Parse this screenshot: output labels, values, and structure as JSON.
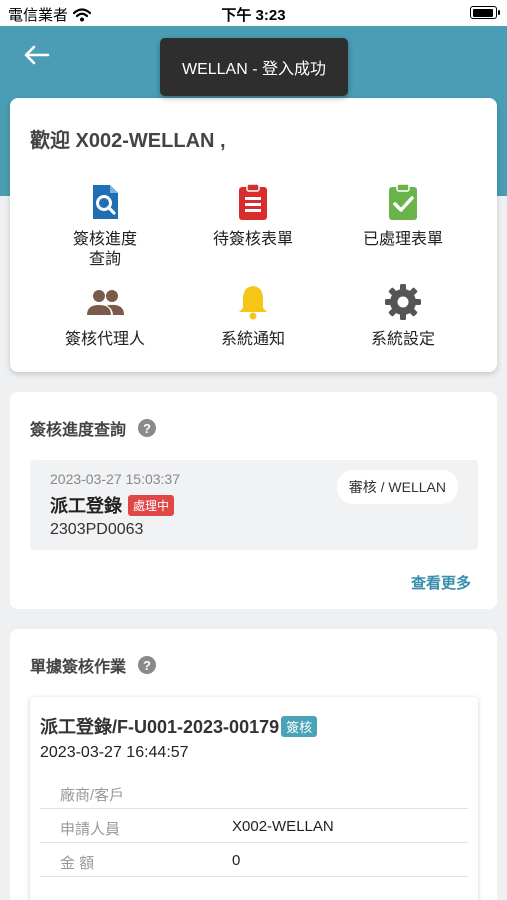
{
  "status_bar": {
    "carrier": "電信業者",
    "time": "下午 3:23"
  },
  "toast": {
    "message": "WELLAN - 登入成功"
  },
  "welcome": {
    "greeting": "歡迎 X002-WELLAN ,",
    "menu": [
      {
        "label": "簽核進度\n查詢",
        "icon": "document-search-icon",
        "color": "#1e6fb3"
      },
      {
        "label": "待簽核表單",
        "icon": "clipboard-list-icon",
        "color": "#d92c2c"
      },
      {
        "label": "已處理表單",
        "icon": "clipboard-check-icon",
        "color": "#6ab34a"
      },
      {
        "label": "簽核代理人",
        "icon": "people-icon",
        "color": "#7a5a4a"
      },
      {
        "label": "系統通知",
        "icon": "bell-icon",
        "color": "#f5c518"
      },
      {
        "label": "系統設定",
        "icon": "gear-icon",
        "color": "#555555"
      }
    ]
  },
  "progress": {
    "title": "簽核進度查詢",
    "item": {
      "time": "2023-03-27 15:03:37",
      "title": "派工登錄",
      "status": "處理中",
      "code": "2303PD0063",
      "tag": "審核 / WELLAN"
    },
    "more": "查看更多"
  },
  "documents": {
    "title": "單據簽核作業",
    "item": {
      "title": "派工登錄/F-U001-2023-00179",
      "badge": "簽核",
      "time": "2023-03-27 16:44:57",
      "rows": [
        {
          "key": "廠商/客戶",
          "value": ""
        },
        {
          "key": "申請人員",
          "value": "X002-WELLAN"
        },
        {
          "key": "金 額",
          "value": "0"
        }
      ]
    }
  },
  "colors": {
    "header": "#4a9db5",
    "accent": "#3a8fb0",
    "status_red": "#e04848",
    "badge_teal": "#4aa3b8"
  }
}
